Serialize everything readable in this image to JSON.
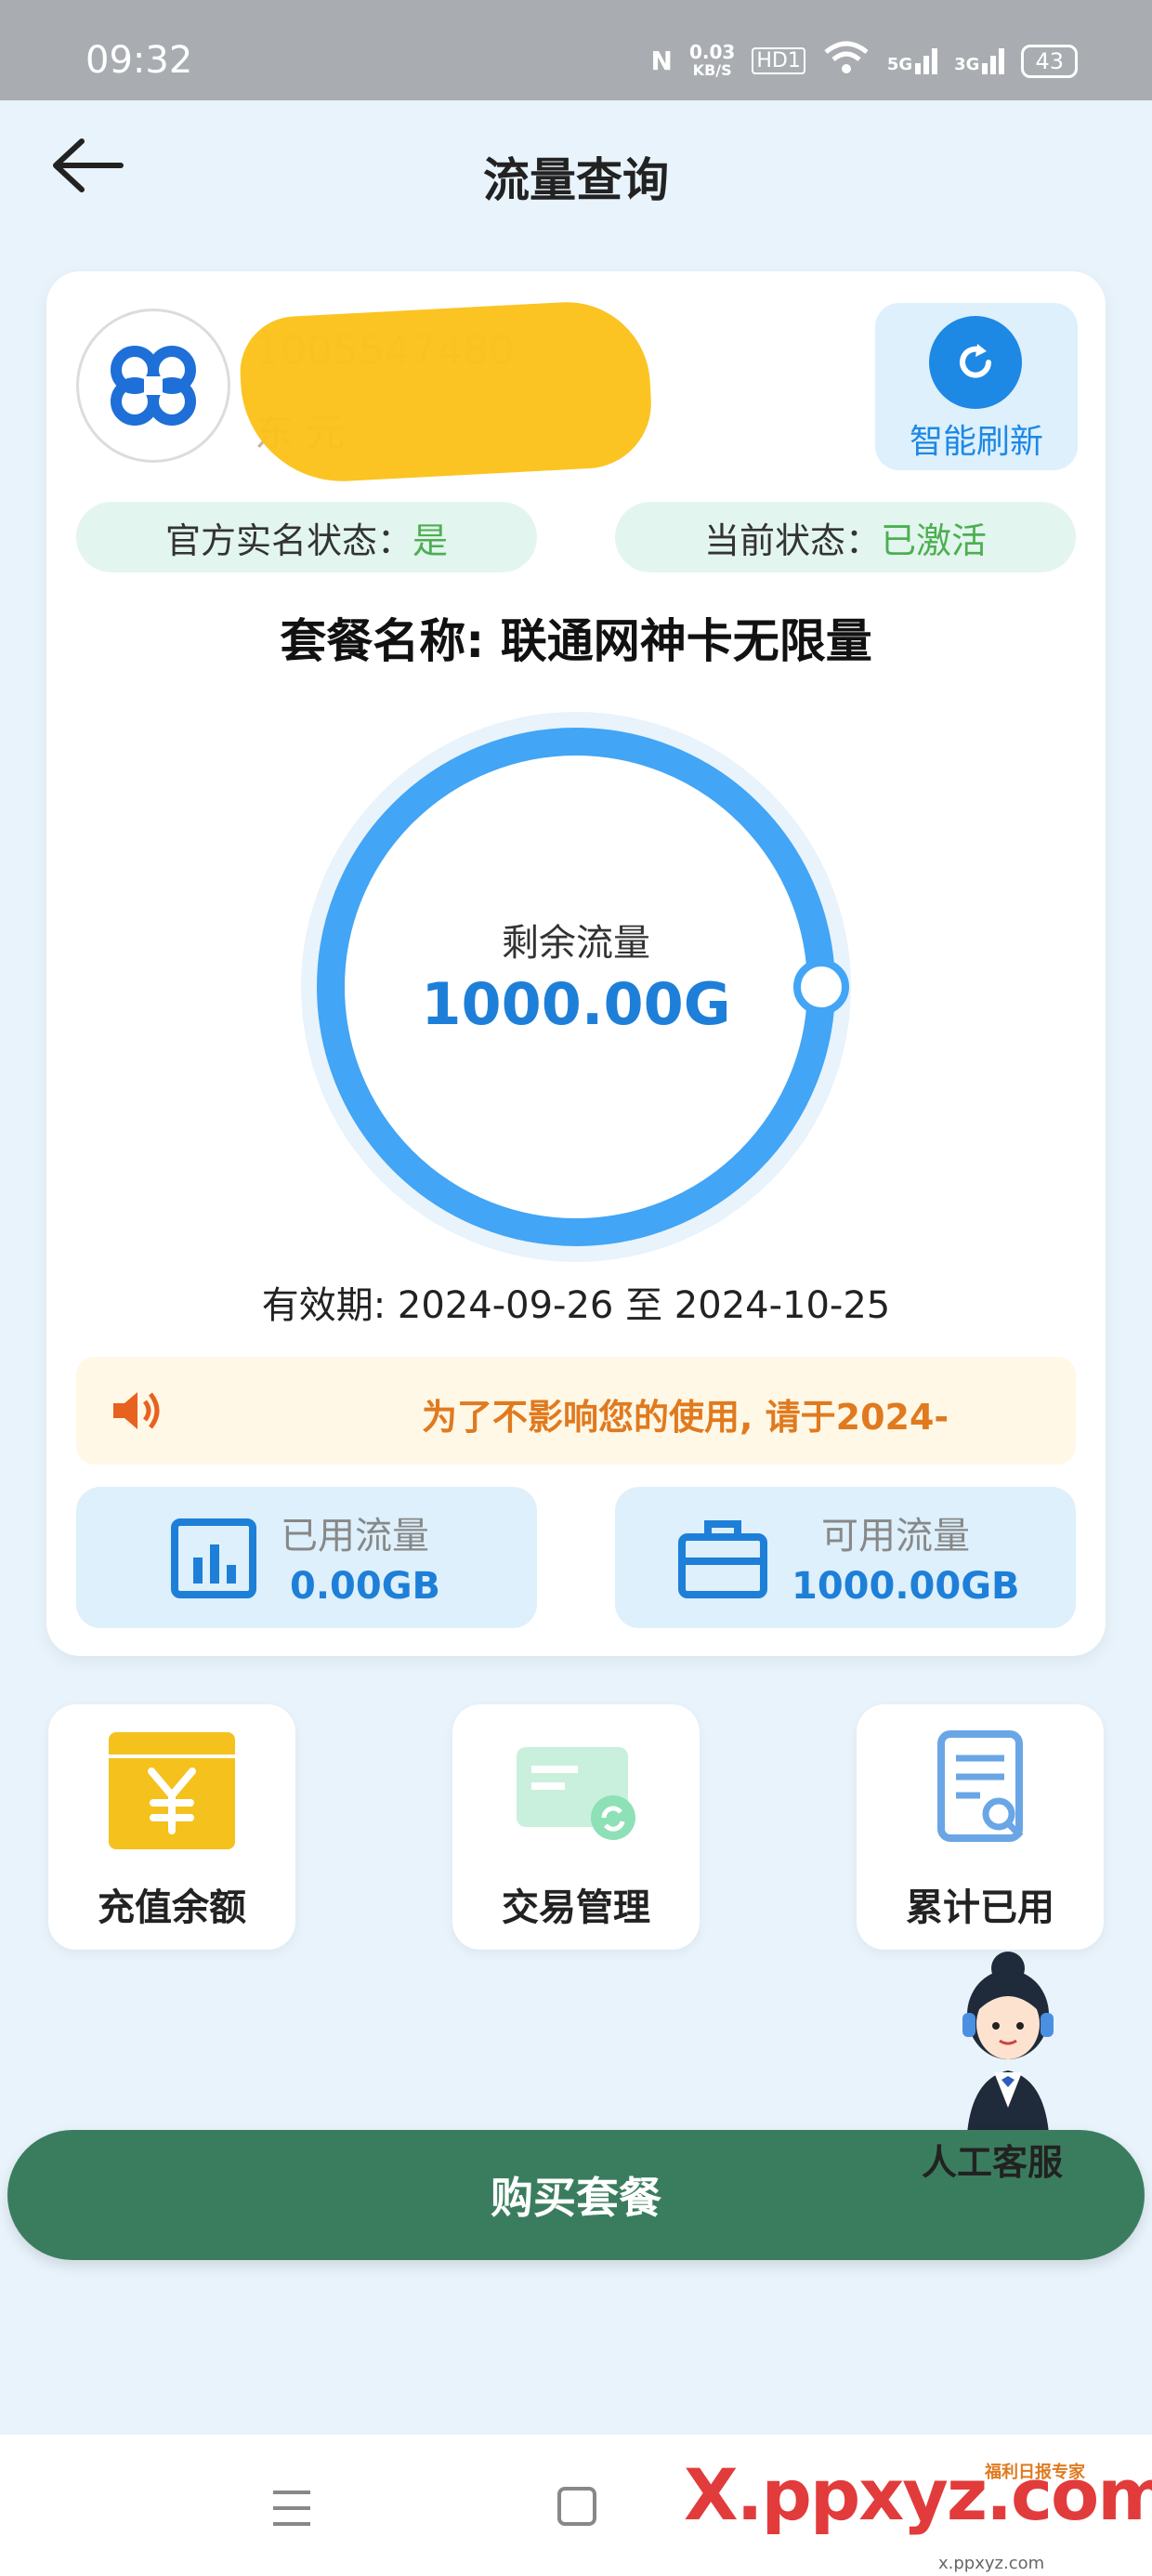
{
  "status_bar": {
    "time": "09:32",
    "speed_value": "0.03",
    "speed_unit": "KB/S",
    "hd_label": "HD1",
    "net_5g": "5G",
    "net_3g": "3G",
    "battery": "43"
  },
  "header": {
    "title": "流量查询"
  },
  "account": {
    "phone": "1005547480",
    "name": "东 元",
    "refresh_label": "智能刷新"
  },
  "status_pills": {
    "realname_label": "官方实名状态：",
    "realname_value": "是",
    "current_label": "当前状态：",
    "current_value": "已激活"
  },
  "plan": {
    "name": "套餐名称: 联通网神卡无限量"
  },
  "gauge": {
    "remaining_label": "剩余流量",
    "remaining_value": "1000.00G",
    "remaining_fraction": 1.0
  },
  "validity": "有效期: 2024-09-26 至 2024-10-25",
  "notice": {
    "text": "为了不影响您的使用, 请于2024-"
  },
  "stats": {
    "used_label": "已用流量",
    "used_value": "0.00GB",
    "available_label": "可用流量",
    "available_value": "1000.00GB"
  },
  "shortcuts": {
    "recharge_label": "充值余额",
    "transactions_label": "交易管理",
    "usage_label": "累计已用"
  },
  "support": {
    "label": "人工客服"
  },
  "buy_button": "购买套餐",
  "watermark": {
    "text": "X.ppxyz.com",
    "small": "x.ppxyz.com",
    "tag": "福利日报专家"
  },
  "colors": {
    "primary_blue": "#1e88e5",
    "green_button": "#3a7d5e",
    "active_green": "#4caf50",
    "notice_orange": "#e07a1f"
  }
}
